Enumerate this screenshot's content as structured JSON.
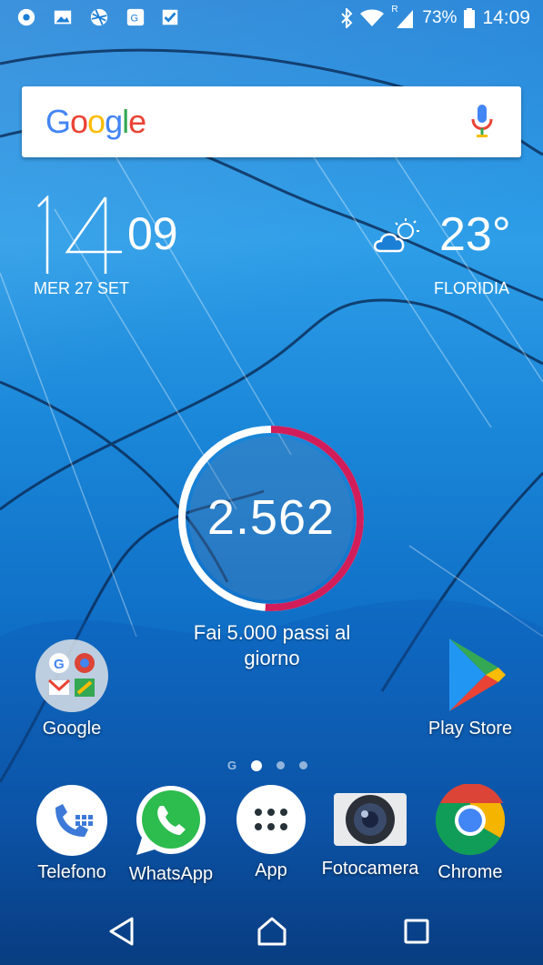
{
  "status_bar": {
    "battery_text": "73%",
    "time": "14:09",
    "roaming_mark": "R",
    "left_icons": [
      "settings-gear-icon",
      "gallery-icon",
      "ball-icon",
      "maps-icon",
      "checklist-icon"
    ]
  },
  "search": {
    "logo": "Google"
  },
  "clock": {
    "hour": "14",
    "minute": "09",
    "date": "MER 27 SET"
  },
  "weather": {
    "temperature": "23°",
    "location": "FLORIDIA",
    "icon": "partly-cloudy-icon"
  },
  "steps": {
    "value": "2.562",
    "caption": "Fai 5.000 passi al giorno",
    "progress": 0.51
  },
  "apps": {
    "google": "Google",
    "play_store": "Play Store"
  },
  "dock": {
    "telefono": "Telefono",
    "whatsapp": "WhatsApp",
    "app": "App",
    "fotocamera": "Fotocamera",
    "chrome": "Chrome"
  },
  "page_indicator": {
    "google_mark": "G",
    "pages": 3,
    "current": 1
  },
  "colors": {
    "ring_progress": "#d11d5a",
    "ring_track": "#ffffff"
  }
}
